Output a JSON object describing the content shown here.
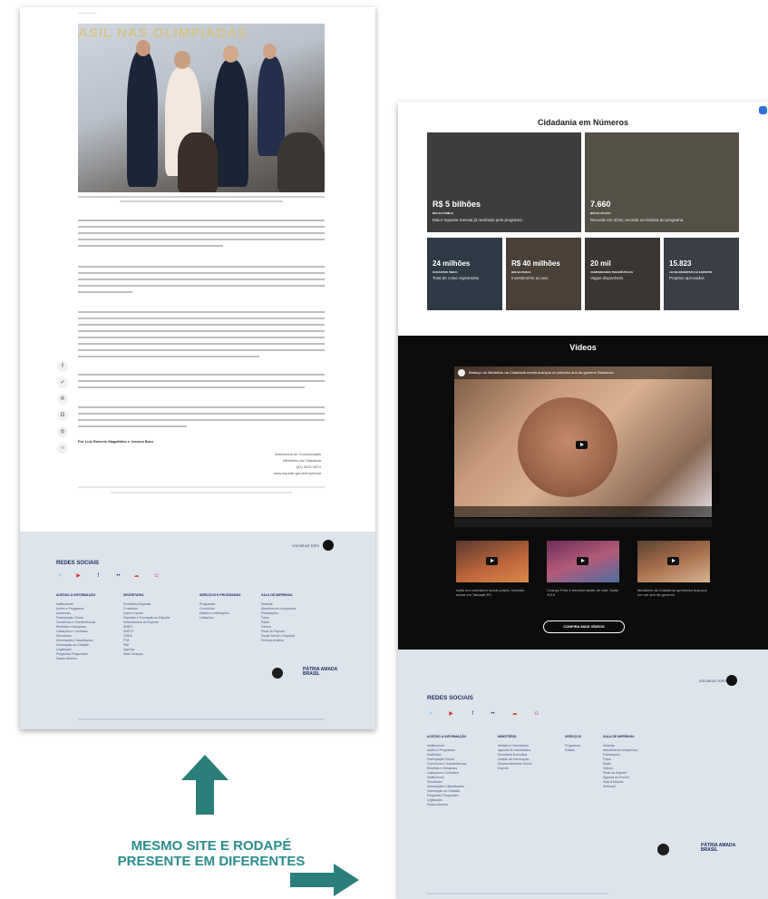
{
  "left_page": {
    "banner": "ASIL NAS OLIMPIADAS",
    "byline": "Por Luiz Roberto Magalhães e Jessica Bacz",
    "signature": [
      "Assessoria de Comunicação",
      "Ministério da Cidadania",
      "(61) 3431-9874",
      "www.esporte.gov.br/imprensa"
    ],
    "share_icons": [
      "facebook-icon",
      "twitter-icon",
      "pinterest-icon",
      "google-plus-icon",
      "whatsapp-icon",
      "messenger-icon"
    ]
  },
  "footer": {
    "go_top": "VOLTAR AO TOPO",
    "redes_sociais": "REDES SOCIAIS",
    "social_colors": [
      "#4aa6e0",
      "#e0332b",
      "#1e3e7a",
      "#3a3a8a",
      "#e04a2b",
      "#e74e9a"
    ],
    "columns_left": [
      {
        "title": "ACESSO À INFORMAÇÃO",
        "items": [
          "Institucional",
          "Ações e Programas",
          "Auditorias",
          "Participação Social",
          "Convênios e Transferências",
          "Receitas e Despesas",
          "Licitações e Contratos",
          "Servidores",
          "Informações Classificadas",
          "Informação ao Cidadão",
          "Legislação",
          "Perguntas Frequentes",
          "Dados Abertos"
        ]
      },
      {
        "title": "SECRETARIA",
        "items": [
          "Secretaria Especial",
          "O ministro",
          "Quem é quem",
          "Esportes e Formação ao Esporte",
          "Infraestrutura do Esporte",
          "SNDIT",
          "SNFUT",
          "CBDA",
          "PTA",
          "PAE",
          "Agenda",
          "Mais Serviços"
        ]
      },
      {
        "title": "SERVIÇOS E PROGRAMAS",
        "items": [
          "Programas",
          "Convênios",
          "Editais e notificações",
          "Licitações"
        ]
      },
      {
        "title": "SALA DE IMPRENSA",
        "items": [
          "Notícias",
          "Atendimento à imprensa",
          "Publicações",
          "Fotos",
          "Rádio",
          "Vídeos",
          "Rede do Esporte",
          "Seção Mercê e Impacto",
          "Revista artística"
        ]
      }
    ],
    "columns_right": [
      {
        "title": "ACESSO À INFORMAÇÃO",
        "items": [
          "Institucional",
          "Ações e Programas",
          "Auditorias",
          "Participação Social",
          "Convênios e Transferências",
          "Receitas e Despesas",
          "Licitações e Contratos",
          "Institucional",
          "Servidores",
          "Informações Classificadas",
          "Informação ao Cidadão",
          "Perguntas Frequentes",
          "Legislação",
          "Dados Abertos"
        ]
      },
      {
        "title": "MINISTÉRIO",
        "items": [
          "Ministro e Secretários",
          "Agenda de autoridades",
          "Secretaria Executiva",
          "Gestão da Informação",
          "Desenvolvimento Social",
          "Esporte"
        ]
      },
      {
        "title": "SERVIÇOS",
        "items": [
          "Programas",
          "Editais"
        ]
      },
      {
        "title": "SALA DE IMPRENSA",
        "items": [
          "Notícias",
          "Atendimento à imprensa",
          "Publicações",
          "Fotos",
          "Rádio",
          "Vídeos",
          "Rede do Esporte",
          "Agenda do Evento",
          "Sala à Marcas",
          "Webmail"
        ]
      }
    ],
    "brasil_logo": "PÁTRIA AMADA BRASIL"
  },
  "right_page": {
    "numbers_title": "Cidadania em Números",
    "cards_big": [
      {
        "value": "R$ 5 bilhões",
        "label": "Bolsa Família",
        "desc": "Maior repasse mensal já realizado pelo programa",
        "bg": "#3b3d3f"
      },
      {
        "value": "7.660",
        "label": "Bolsa Atleta",
        "desc": "Recorde em 2019, recorde na história do programa",
        "bg": "#555046"
      }
    ],
    "cards_small": [
      {
        "value": "24 milhões",
        "label": "Cadastro Único",
        "desc": "Total de cotas registradas",
        "bg": "#2e3a45"
      },
      {
        "value": "R$ 40 milhões",
        "label": "Bolsa Pesca",
        "desc": "Investimento ao ano",
        "bg": "#4a4038"
      },
      {
        "value": "20 mil",
        "label": "Comunidades Terapêuticas",
        "desc": "Vagas disponíveis",
        "bg": "#3c3632"
      },
      {
        "value": "15.823",
        "label": "Lei de Incentivo ao Esporte",
        "desc": "Projetos aprovados",
        "bg": "#3a3f46"
      }
    ],
    "videos_title": "Vídeos",
    "main_video_title": "Balanço do Ministério da Cidadania revela avanços no primeiro ano do governo Bolsonaro",
    "videos": [
      {
        "caption": "Ação em contratura social projeto Inclusão social em Tatuapé-RS"
      },
      {
        "caption": "Criança Feliz é transformação de vida: Natal 2019"
      },
      {
        "caption": "Ministério da Cidadania apresenta avanços em um ano de governo"
      }
    ],
    "more_button": "CONFIRA MAIS VÍDEOS"
  },
  "annotation": "MESMO SITE E RODAPÉ PRESENTE EM DIFERENTES"
}
